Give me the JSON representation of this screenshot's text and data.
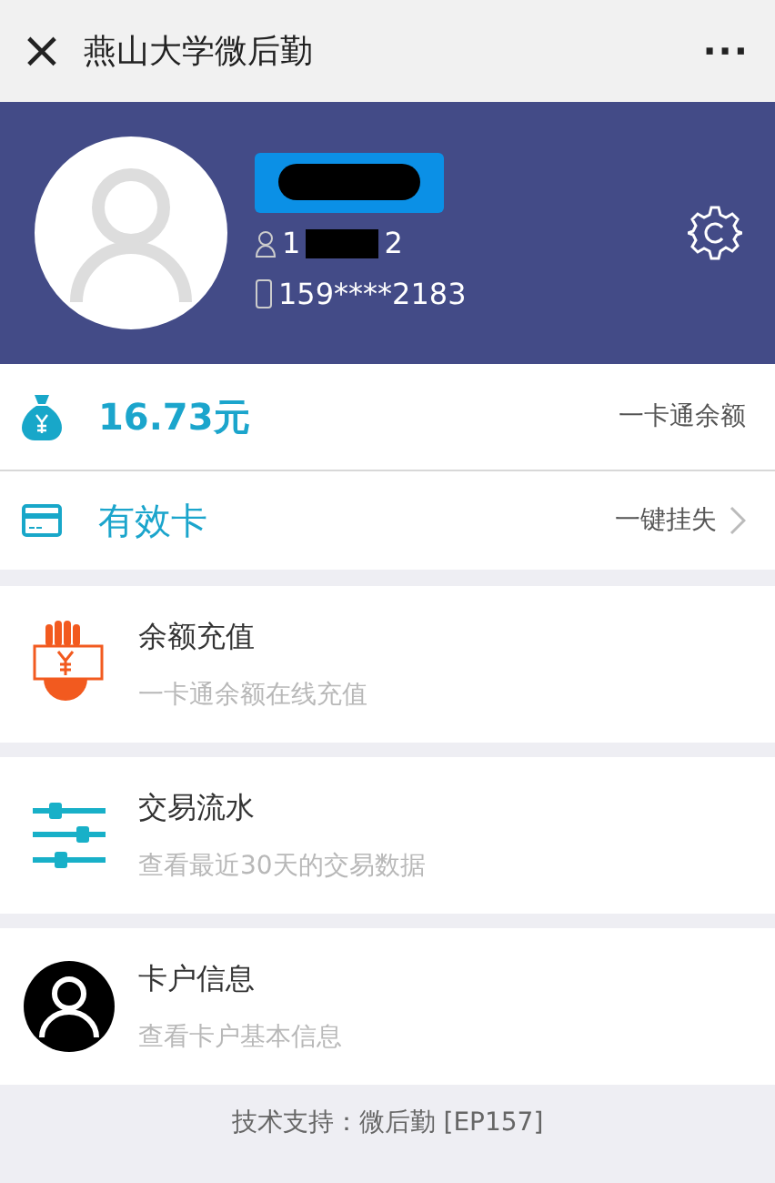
{
  "title_bar": {
    "close_icon": "×",
    "title": "燕山大学微后勤",
    "more": "···"
  },
  "profile": {
    "id_start": "1",
    "id_end": "2",
    "phone": "159****2183"
  },
  "balance": {
    "amount": "16.73元",
    "label": "一卡通余额"
  },
  "card": {
    "status": "有效卡",
    "action": "一键挂失"
  },
  "menu": [
    {
      "kind": "recharge",
      "title": "余额充值",
      "subtitle": "一卡通余额在线充值"
    },
    {
      "kind": "transactions",
      "title": "交易流水",
      "subtitle": "查看最近30天的交易数据"
    },
    {
      "kind": "account",
      "title": "卡户信息",
      "subtitle": "查看卡户基本信息"
    }
  ],
  "footer": "技术支持：微后勤 [EP157]"
}
